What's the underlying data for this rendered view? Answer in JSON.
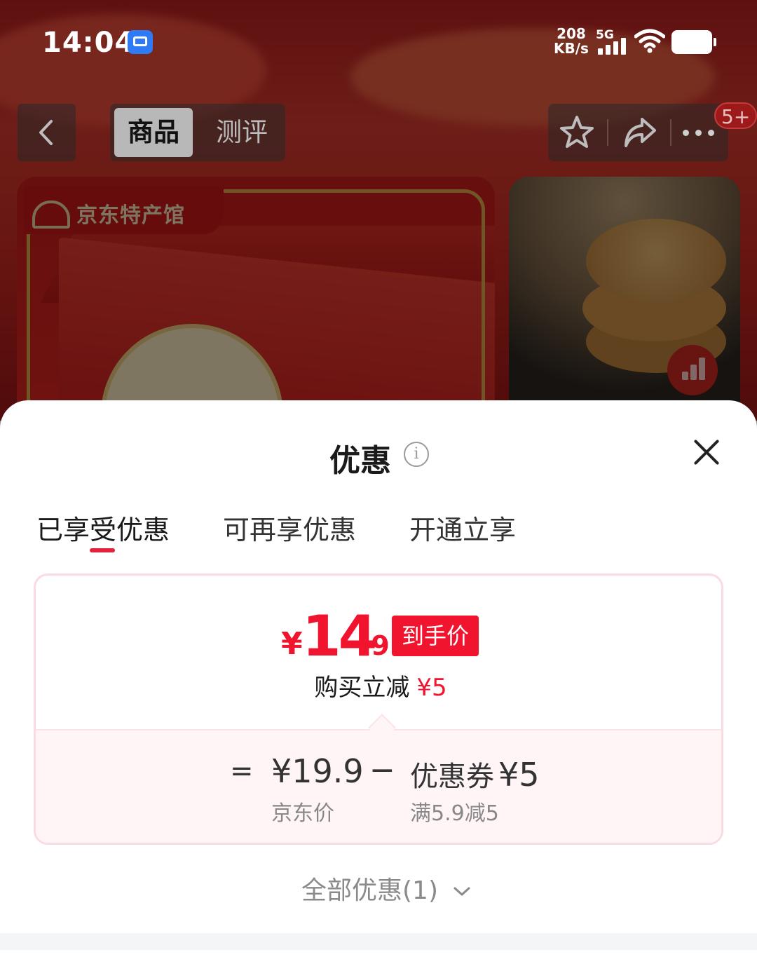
{
  "status_bar": {
    "time": "14:04",
    "speed_value": "208",
    "speed_unit": "KB/s",
    "network": "5G"
  },
  "top_nav": {
    "tabs": [
      "商品",
      "测评"
    ],
    "cart_badge": "5+"
  },
  "background": {
    "store_tag": "京东特产馆"
  },
  "sheet": {
    "title": "优惠",
    "tabs": [
      "已享受优惠",
      "可再享优惠",
      "开通立享"
    ],
    "active_tab_index": 0,
    "final_price": {
      "currency": "¥",
      "integer": "14",
      "decimal": ".9",
      "badge": "到手价"
    },
    "reduce": {
      "label": "购买立减",
      "amount": "¥5"
    },
    "breakdown": {
      "equals": "=",
      "jd_price": "¥19.9",
      "jd_price_label": "京东价",
      "minus": "−",
      "coupon_label": "优惠券",
      "coupon_amount": "¥5",
      "coupon_condition": "满5.9减5"
    },
    "all_discounts": "全部优惠(1)"
  },
  "colors": {
    "accent": "#f0142e",
    "card_border": "#fadbe2",
    "card_bottom_bg": "#fff5f7"
  },
  "icons": [
    "back-arrow-icon",
    "star-icon",
    "share-icon",
    "more-icon",
    "info-icon",
    "close-icon",
    "chevron-down-icon",
    "chart-icon"
  ]
}
